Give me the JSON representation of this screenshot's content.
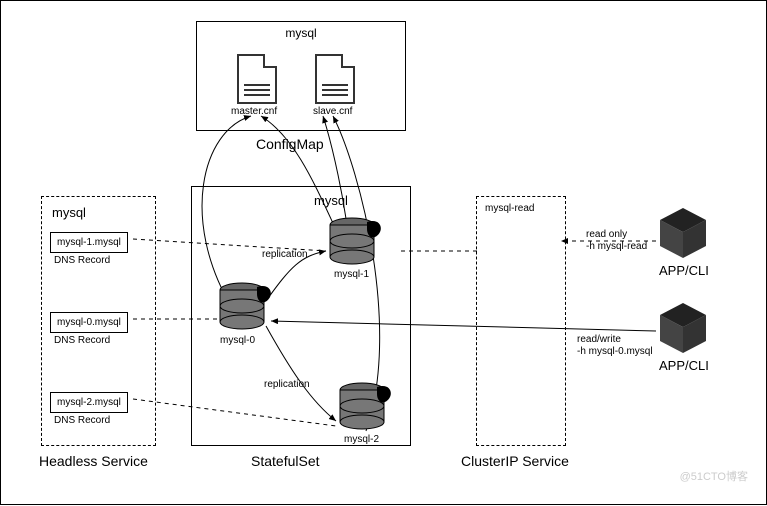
{
  "configmap": {
    "title": "mysql",
    "doc1": "master.cnf",
    "doc2": "slave.cnf",
    "label": "ConfigMap"
  },
  "headless": {
    "title": "mysql",
    "records": [
      {
        "name": "mysql-1.mysql",
        "caption": "DNS Record"
      },
      {
        "name": "mysql-0.mysql",
        "caption": "DNS Record"
      },
      {
        "name": "mysql-2.mysql",
        "caption": "DNS Record"
      }
    ],
    "label": "Headless Service"
  },
  "stateful": {
    "title": "mysql",
    "pods": [
      {
        "name": "mysql-1"
      },
      {
        "name": "mysql-0"
      },
      {
        "name": "mysql-2"
      }
    ],
    "replication": "replication",
    "label": "StatefulSet"
  },
  "clusterip": {
    "title": "mysql-read",
    "label": "ClusterIP Service"
  },
  "clients": [
    {
      "line1": "read only",
      "line2": "-h mysql-read",
      "caption": "APP/CLI"
    },
    {
      "line1": "read/write",
      "line2": "-h mysql-0.mysql",
      "caption": "APP/CLI"
    }
  ],
  "watermark": "@51CTO博客"
}
